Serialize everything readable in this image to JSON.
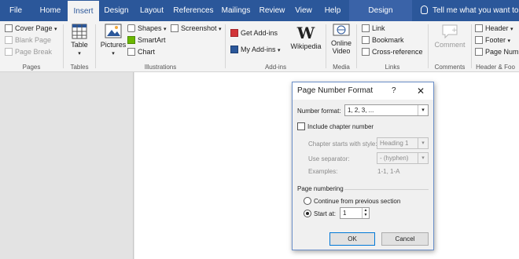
{
  "tabs": [
    {
      "id": "file",
      "label": "File"
    },
    {
      "id": "home",
      "label": "Home"
    },
    {
      "id": "insert",
      "label": "Insert",
      "active": true
    },
    {
      "id": "design",
      "label": "Design"
    },
    {
      "id": "layout",
      "label": "Layout"
    },
    {
      "id": "references",
      "label": "References"
    },
    {
      "id": "mailings",
      "label": "Mailings"
    },
    {
      "id": "review",
      "label": "Review"
    },
    {
      "id": "view",
      "label": "View"
    },
    {
      "id": "help",
      "label": "Help"
    },
    {
      "id": "design2",
      "label": "Design"
    }
  ],
  "tell_me": "Tell me what you want to do",
  "ribbon": {
    "pages": {
      "label": "Pages",
      "cover_page": "Cover Page",
      "blank_page": "Blank Page",
      "page_break": "Page Break"
    },
    "tables": {
      "label": "Tables",
      "table": "Table"
    },
    "illustrations": {
      "label": "Illustrations",
      "pictures": "Pictures",
      "shapes": "Shapes",
      "smartart": "SmartArt",
      "chart": "Chart",
      "screenshot": "Screenshot"
    },
    "addins": {
      "label": "Add-ins",
      "get_addins": "Get Add-ins",
      "my_addins": "My Add-ins",
      "wikipedia": "Wikipedia"
    },
    "media": {
      "label": "Media",
      "online": "Online",
      "video": "Video"
    },
    "links": {
      "label": "Links",
      "link": "Link",
      "bookmark": "Bookmark",
      "cross_reference": "Cross-reference"
    },
    "comments": {
      "label": "Comments",
      "comment": "Comment"
    },
    "header_footer": {
      "label": "Header & Foo",
      "header": "Header",
      "footer": "Footer",
      "page_number": "Page Num"
    }
  },
  "dialog": {
    "title": "Page Number Format",
    "help": "?",
    "close": "✕",
    "number_format_label": "Number format:",
    "number_format_value": "1, 2, 3, ...",
    "include_chapter_label": "Include chapter number",
    "include_chapter_checked": false,
    "chapter_starts_label": "Chapter starts with style:",
    "chapter_starts_value": "Heading 1",
    "separator_label": "Use separator:",
    "separator_value": "-    (hyphen)",
    "examples_label": "Examples:",
    "examples_value": "1-1, 1-A",
    "numbering_label": "Page numbering",
    "continue_label": "Continue from previous section",
    "start_at_label": "Start at:",
    "start_at_value": "1",
    "ok": "OK",
    "cancel": "Cancel"
  },
  "colors": {
    "accent": "#2b579a",
    "ribbon_bg": "#f3f3f3",
    "dialog_border": "#6b8fc9"
  }
}
